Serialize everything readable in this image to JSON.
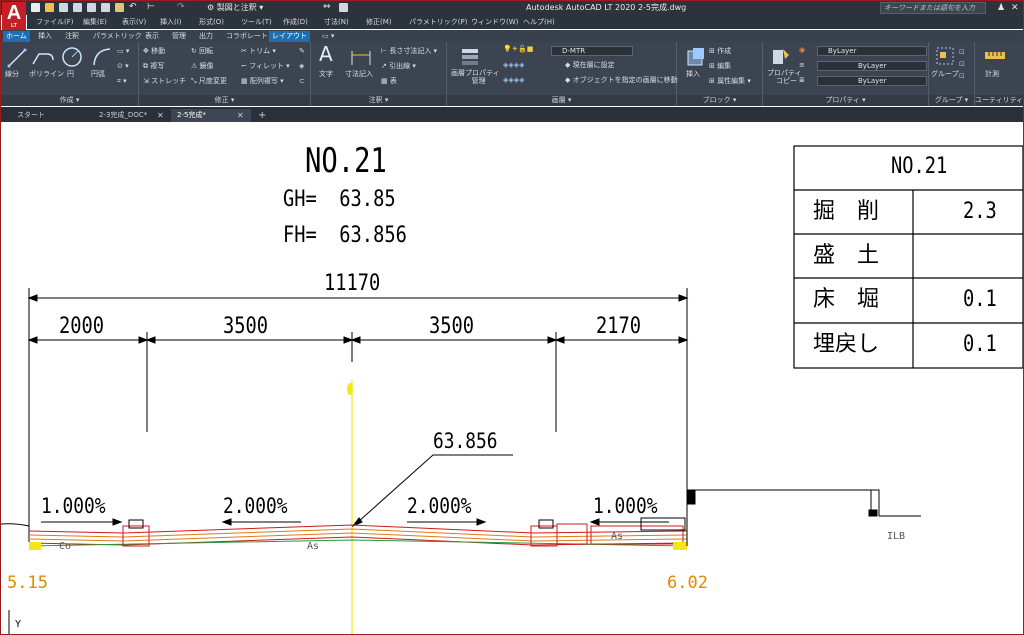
{
  "app": {
    "logo_letter": "A",
    "logo_sub": "LT",
    "workspace": "製図と注釈",
    "window_title": "Autodesk AutoCAD LT 2020   2-5完成.dwg",
    "search_placeholder": "キーワードまたは語句を入力",
    "close_glyph": "✕",
    "user_glyph": "♟"
  },
  "menu": [
    "ファイル(F)",
    "編集(E)",
    "表示(V)",
    "挿入(I)",
    "形式(O)",
    "ツール(T)",
    "作成(D)",
    "寸法(N)",
    "修正(M)",
    "パラメトリック(P)",
    "ウィンドウ(W)",
    "ヘルプ(H)"
  ],
  "ribbon_tabs": [
    "ホーム",
    "挿入",
    "注釈",
    "パラメトリック",
    "表示",
    "管理",
    "出力",
    "コラボレート",
    "レイアウト"
  ],
  "ribbon_active_tab": "レイアウト",
  "ribbon": {
    "draw": {
      "title": "作成 ▾",
      "line": "線分",
      "polyline": "ポリライン",
      "circle": "円",
      "arc": "円弧"
    },
    "modify": {
      "title": "修正 ▾",
      "move": "移動",
      "rotate": "回転",
      "trim": "トリム ▾",
      "copy": "複写",
      "mirror": "鏡像",
      "fillet": "フィレット ▾",
      "stretch": "ストレッチ",
      "scale": "尺度変更",
      "array": "配列複写 ▾"
    },
    "annotation": {
      "title": "注釈 ▾",
      "text": "文字",
      "dimension": "寸法記入",
      "linear": "長さ寸法記入 ▾",
      "leader": "引出線 ▾",
      "table": "表"
    },
    "layers": {
      "title": "画層 ▾",
      "properties": "画層プロパティ\n管理",
      "current_layer": "D-MTR",
      "set_current": "現在層に設定",
      "match_layer": "オブジェクトを指定の画層に移動"
    },
    "block": {
      "title": "ブロック ▾",
      "insert": "挿入",
      "create": "作成",
      "edit": "編集",
      "edit_attr": "属性編集 ▾"
    },
    "properties": {
      "title": "プロパティ ▾",
      "match": "プロパティ\nコピー",
      "color": "ByLayer",
      "linetype": "ByLayer",
      "lineweight": "ByLayer"
    },
    "groups": {
      "title": "グループ ▾",
      "group": "グループ"
    },
    "utilities": {
      "title": "ユーティリティ ▾",
      "measure": "計測"
    }
  },
  "file_tabs": [
    {
      "label": "スタート",
      "closable": false,
      "active": false
    },
    {
      "label": "2-3完成_DOC*",
      "closable": true,
      "active": false
    },
    {
      "label": "2-5完成*",
      "closable": true,
      "active": true
    }
  ],
  "add_tab": "+",
  "drawing": {
    "section_no": "NO.21",
    "gh": "GH=  63.85",
    "fh": "FH=  63.856",
    "total_width": "11170",
    "widths": [
      "2000",
      "3500",
      "3500",
      "2170"
    ],
    "center_elev": "63.856",
    "slopes": [
      "1.000%",
      "2.000%",
      "2.000%",
      "1.000%"
    ],
    "labels": {
      "left_material": "Co",
      "mid_left": "As",
      "mid_right": "As",
      "right_far": "ILB"
    },
    "left_elev": "5.15",
    "right_elev": "6.02",
    "ucs_y": "Y",
    "colors": {
      "yellow": "#f5e61c",
      "orange": "#e07a1a",
      "red": "#d11a1a",
      "green": "#2a9a3a",
      "elev_text": "#e08a00"
    }
  },
  "earthwork_table": {
    "title": "NO.21",
    "rows": [
      {
        "label": "掘　削",
        "value": "2.3"
      },
      {
        "label": "盛　土",
        "value": ""
      },
      {
        "label": "床　堀",
        "value": "0.1"
      },
      {
        "label": "埋戻し",
        "value": "0.1"
      }
    ]
  }
}
